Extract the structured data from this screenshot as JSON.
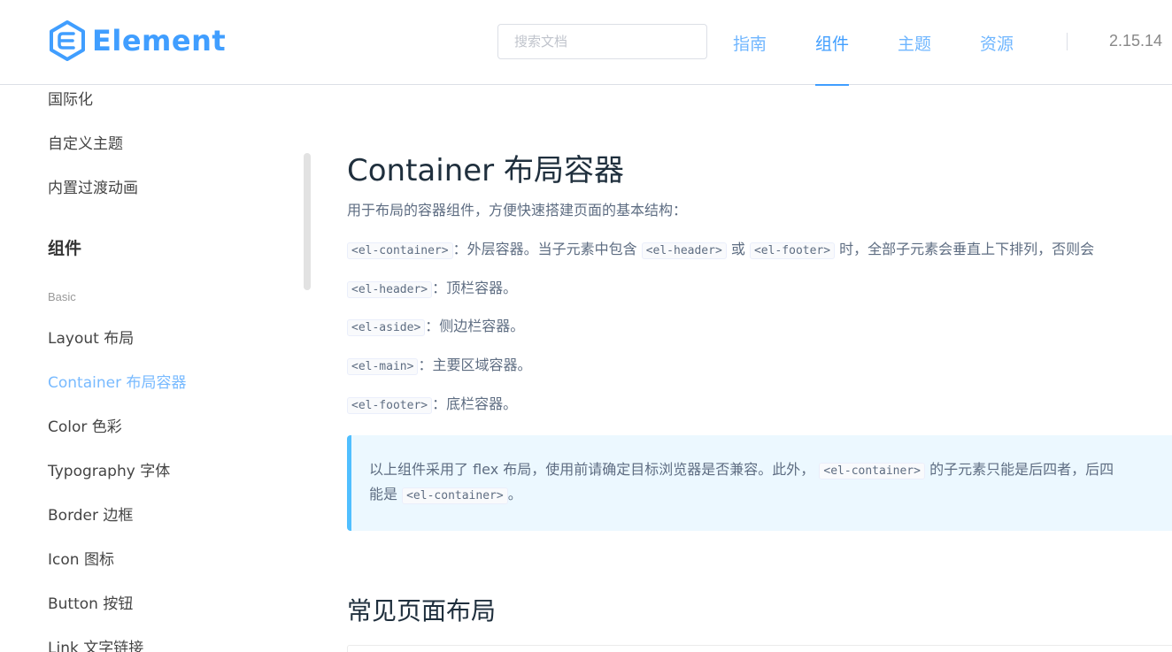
{
  "header": {
    "logo_text": "Element",
    "search_placeholder": "搜索文档",
    "nav": [
      {
        "label": "指南"
      },
      {
        "label": "组件"
      },
      {
        "label": "主题"
      },
      {
        "label": "资源"
      }
    ],
    "active_nav": "组件",
    "version": "2.15.14",
    "accent_color": "#409eff"
  },
  "sidebar": {
    "links_top": [
      "国际化",
      "自定义主题",
      "内置过渡动画"
    ],
    "group_title": "组件",
    "subgroup": "Basic",
    "items": [
      "Layout 布局",
      "Container 布局容器",
      "Color 色彩",
      "Typography 字体",
      "Border 边框",
      "Icon 图标",
      "Button 按钮",
      "Link 文字链接"
    ],
    "active_item": "Container 布局容器"
  },
  "main": {
    "title": "Container 布局容器",
    "intro": "用于布局的容器组件，方便快速搭建页面的基本结构：",
    "desc1": {
      "tag1": "<el-container>",
      "text1": "：外层容器。当子元素中包含",
      "tag2": "<el-header>",
      "text2": "或",
      "tag3": "<el-footer>",
      "text3": "时，全部子元素会垂直上下排列，否则会"
    },
    "desc2": {
      "tag": "<el-header>",
      "text": "：顶栏容器。"
    },
    "desc3": {
      "tag": "<el-aside>",
      "text": "：侧边栏容器。"
    },
    "desc4": {
      "tag": "<el-main>",
      "text": "：主要区域容器。"
    },
    "desc5": {
      "tag": "<el-footer>",
      "text": "：底栏容器。"
    },
    "tip": {
      "line1_text1": "以上组件采用了 flex 布局，使用前请确定目标浏览器是否兼容。此外，",
      "line1_tag": "<el-container>",
      "line1_text2": "的子元素只能是后四者，后四",
      "line2_text1": "能是",
      "line2_tag": "<el-container>",
      "line2_text2": "。"
    },
    "section_title": "常见页面布局"
  }
}
